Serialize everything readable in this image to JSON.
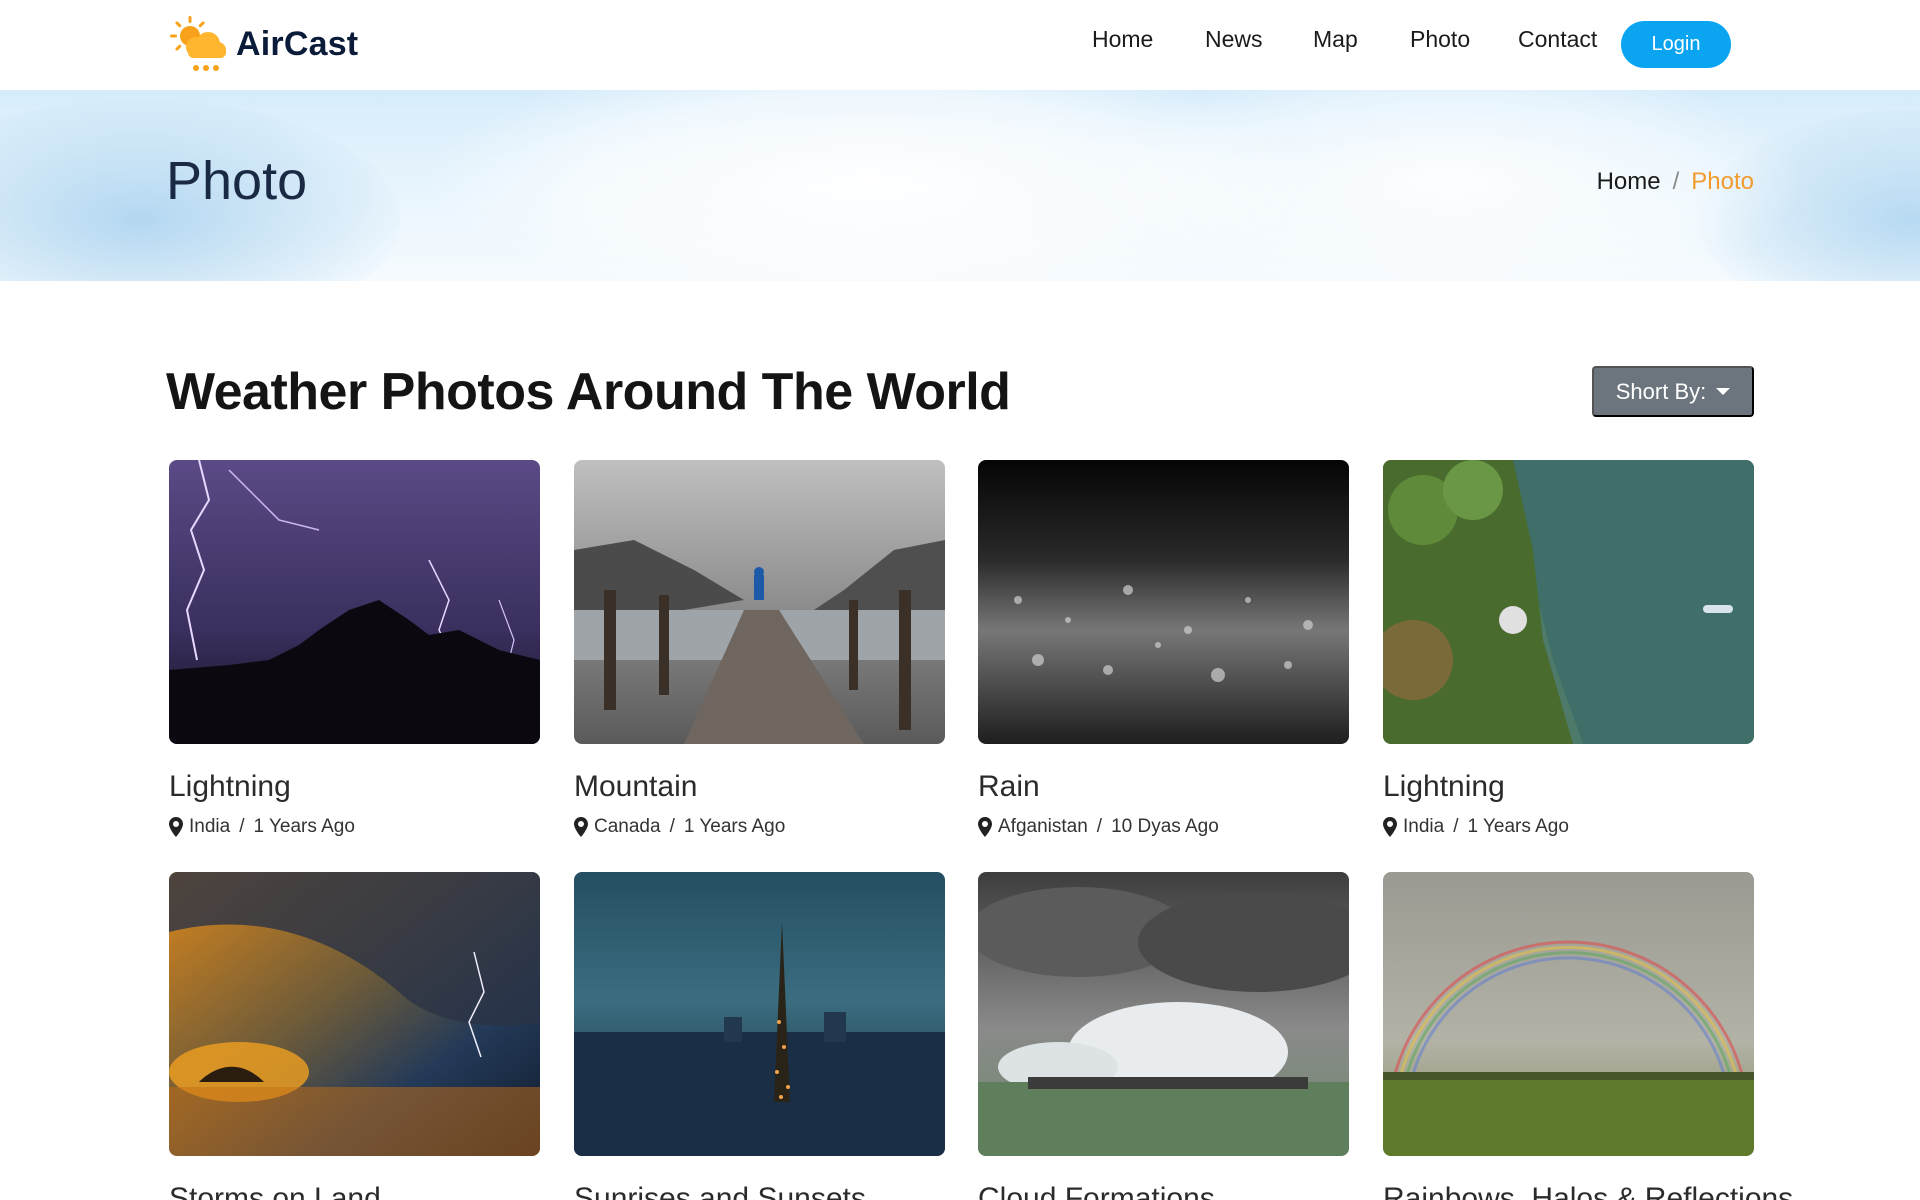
{
  "brand": {
    "name": "AirCast"
  },
  "nav": {
    "items": [
      {
        "label": "Home"
      },
      {
        "label": "News"
      },
      {
        "label": "Map"
      },
      {
        "label": "Photo"
      },
      {
        "label": "Contact"
      }
    ],
    "login_label": "Login"
  },
  "hero": {
    "title": "Photo",
    "breadcrumb": {
      "home": "Home",
      "separator": "/",
      "current": "Photo"
    }
  },
  "section": {
    "title": "Weather Photos Around The World",
    "sort_label": "Short By:"
  },
  "cards": [
    {
      "title": "Lightning",
      "location": "India",
      "separator": "/",
      "time": "1 Years Ago"
    },
    {
      "title": "Mountain",
      "location": "Canada",
      "separator": "/",
      "time": "1 Years Ago"
    },
    {
      "title": "Rain",
      "location": "Afganistan",
      "separator": "/",
      "time": "10 Dyas Ago"
    },
    {
      "title": "Lightning",
      "location": "India",
      "separator": "/",
      "time": "1 Years Ago"
    },
    {
      "title": "Storms on Land"
    },
    {
      "title": "Sunrises and Sunsets"
    },
    {
      "title": "Cloud Formations"
    },
    {
      "title": "Rainbows, Halos & Reflections"
    }
  ],
  "colors": {
    "accent": "#0aa4f0",
    "breadcrumb_current": "#f29a2e",
    "sort_button": "#6c757d",
    "brand_text": "#0b1b3a"
  }
}
